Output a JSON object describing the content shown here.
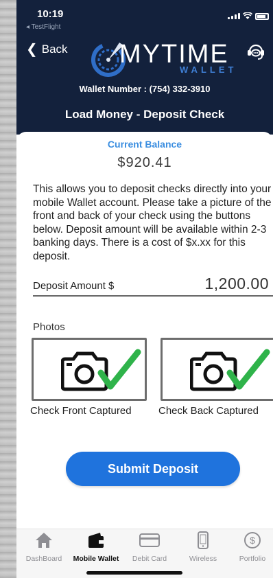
{
  "status": {
    "time": "10:19",
    "back_app": "◂ TestFlight"
  },
  "header": {
    "back_label": "Back",
    "logo_main": "MYTIME",
    "logo_sub": "WALLET",
    "wallet_number": "Wallet Number : (754) 332-3910",
    "page_title": "Load Money - Deposit Check"
  },
  "balance": {
    "label": "Current Balance",
    "value": "$920.41"
  },
  "description": "This allows you to deposit checks directly into your mobile Wallet account. Please take a picture of the front and back of your check using the buttons below.  Deposit amount will be available within 2-3 banking days.  There is a cost of $x.xx for this deposit.",
  "deposit": {
    "label": "Deposit Amount $",
    "value": "1,200.00"
  },
  "photos": {
    "label": "Photos",
    "front_caption": "Check Front Captured",
    "back_caption": "Check Back Captured"
  },
  "submit_label": "Submit Deposit",
  "tabs": [
    {
      "label": "DashBoard",
      "icon": "home-icon"
    },
    {
      "label": "Mobile Wallet",
      "icon": "wallet-icon"
    },
    {
      "label": "Debit Card",
      "icon": "card-icon"
    },
    {
      "label": "Wireless",
      "icon": "phone-icon"
    },
    {
      "label": "Portfolio",
      "icon": "dollar-coin-icon"
    }
  ],
  "colors": {
    "header_bg": "#13213c",
    "accent_blue": "#1f73dd",
    "balance_label": "#3b8ee0",
    "check_green": "#2fb34a"
  }
}
